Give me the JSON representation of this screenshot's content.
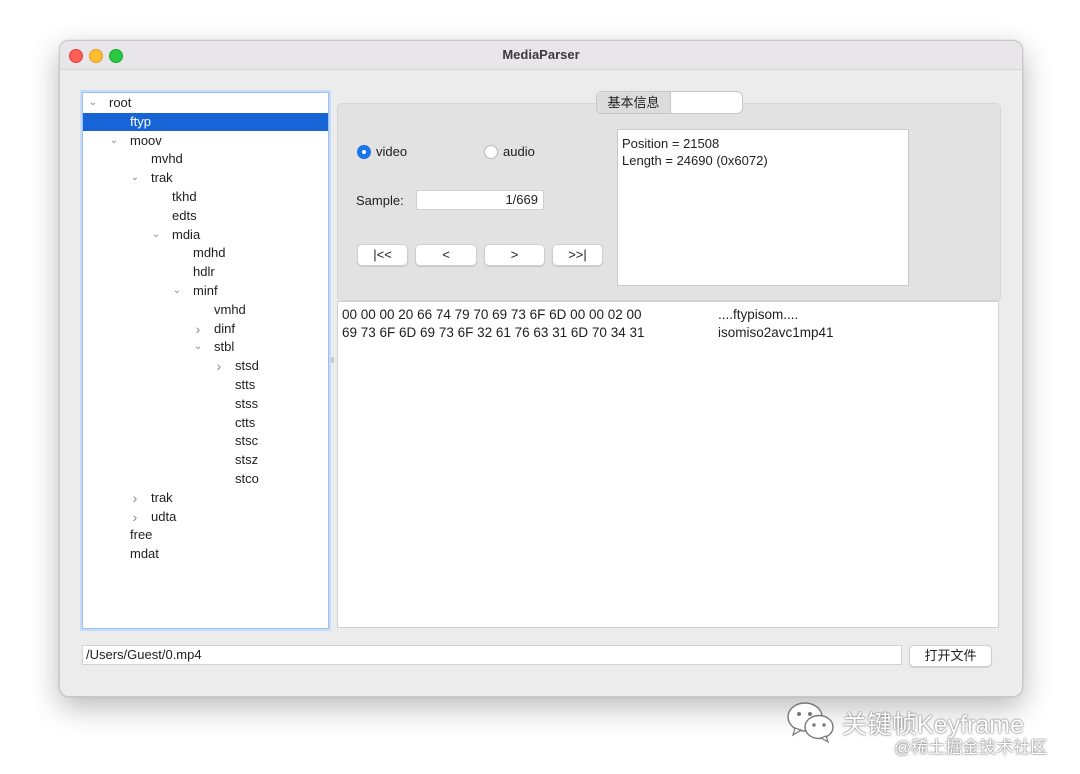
{
  "window": {
    "title": "MediaParser"
  },
  "tree": {
    "nodes": [
      {
        "label": "root",
        "expanded": true
      },
      {
        "label": "ftyp",
        "selected": true
      },
      {
        "label": "moov",
        "expanded": true
      },
      {
        "label": "mvhd"
      },
      {
        "label": "trak",
        "expanded": true
      },
      {
        "label": "tkhd"
      },
      {
        "label": "edts"
      },
      {
        "label": "mdia",
        "expanded": true
      },
      {
        "label": "mdhd"
      },
      {
        "label": "hdlr"
      },
      {
        "label": "minf",
        "expanded": true
      },
      {
        "label": "vmhd"
      },
      {
        "label": "dinf",
        "expanded": false
      },
      {
        "label": "stbl",
        "expanded": true
      },
      {
        "label": "stsd",
        "expanded": false
      },
      {
        "label": "stts"
      },
      {
        "label": "stss"
      },
      {
        "label": "ctts"
      },
      {
        "label": "stsc"
      },
      {
        "label": "stsz"
      },
      {
        "label": "stco"
      },
      {
        "label": "trak",
        "expanded": false
      },
      {
        "label": "udta",
        "expanded": false
      },
      {
        "label": "free"
      },
      {
        "label": "mdat"
      }
    ]
  },
  "tabs": [
    {
      "label": "基本信息",
      "selected": true
    },
    {
      "label": ""
    }
  ],
  "track": {
    "options": [
      {
        "label": "video",
        "checked": true
      },
      {
        "label": "audio",
        "checked": false
      }
    ]
  },
  "sample": {
    "label": "Sample:",
    "value": "1/669"
  },
  "nav": {
    "first": "|<<",
    "prev": "<",
    "next": ">",
    "last": ">>|"
  },
  "info": {
    "position": "Position = 21508",
    "length": "Length = 24690 (0x6072)"
  },
  "hex": {
    "rows": [
      {
        "bytes": "00 00 00 20 66 74 79 70 69 73 6F 6D 00 00 02 00",
        "ascii": "....ftypisom...."
      },
      {
        "bytes": "69 73 6F 6D 69 73 6F 32 61 76 63 31 6D 70 34 31",
        "ascii": "isomiso2avc1mp41"
      }
    ]
  },
  "file": {
    "path": "/Users/Guest/0.mp4",
    "open_label": "打开文件"
  },
  "watermark": {
    "title": "关键帧Keyframe",
    "subtitle": "@稀土掘金技术社区",
    "icon": "wechat-icon"
  }
}
